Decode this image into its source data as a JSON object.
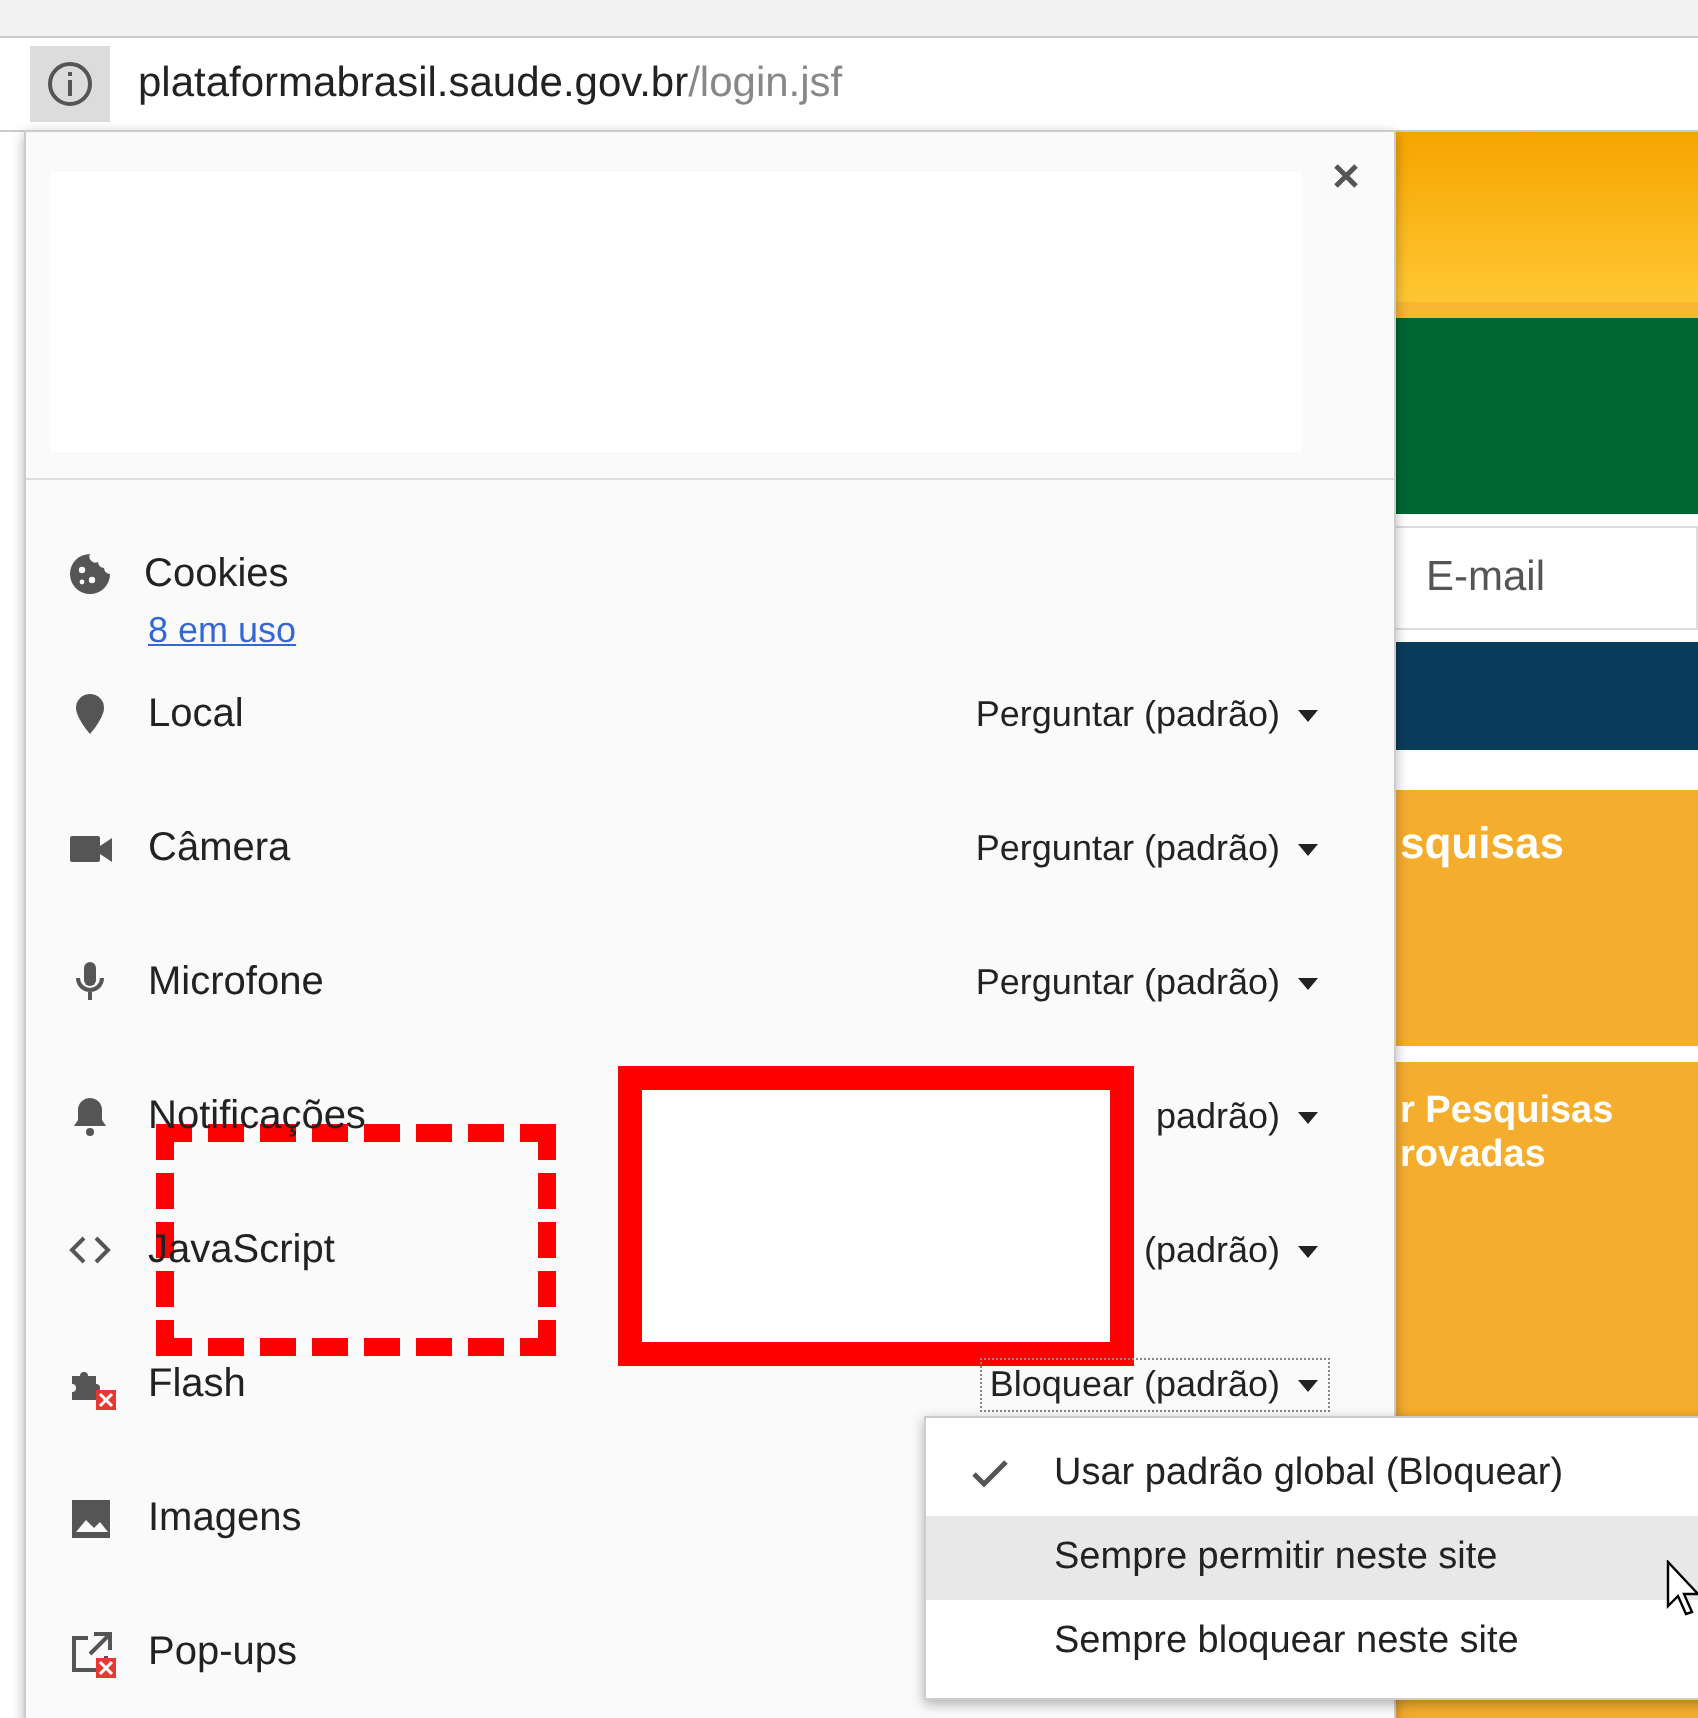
{
  "address_bar": {
    "host": "plataformabrasil.saude.gov.br",
    "path": "/login.jsf"
  },
  "page_behind": {
    "email_field": "E-mail",
    "card_1": "squisas",
    "card_2_line_1": "r Pesquisas",
    "card_2_line_2": "rovadas"
  },
  "site_info_popup": {
    "cookies": {
      "label": "Cookies",
      "link": "8 em uso"
    },
    "permissions": [
      {
        "label": "Local",
        "value": "Perguntar (padrão)",
        "blocked": false,
        "focused": false
      },
      {
        "label": "Câmera",
        "value": "Perguntar (padrão)",
        "blocked": false,
        "focused": false
      },
      {
        "label": "Microfone",
        "value": "Perguntar (padrão)",
        "blocked": false,
        "focused": false
      },
      {
        "label": "Notificações",
        "value": "padrão)",
        "blocked": false,
        "focused": false
      },
      {
        "label": "JavaScript",
        "value": "(padrão)",
        "blocked": false,
        "focused": false
      },
      {
        "label": "Flash",
        "value": "Bloquear (padrão)",
        "blocked": true,
        "focused": true
      },
      {
        "label": "Imagens",
        "blocked": false,
        "focused": false
      },
      {
        "label": "Pop-ups",
        "blocked": true,
        "focused": false
      }
    ]
  },
  "dropdown_menu": [
    {
      "label": "Usar padrão global (Bloquear)",
      "checked": true,
      "selected": false
    },
    {
      "label": "Sempre permitir neste site",
      "checked": false,
      "selected": true
    },
    {
      "label": "Sempre bloquear neste site",
      "checked": false,
      "selected": false
    }
  ]
}
